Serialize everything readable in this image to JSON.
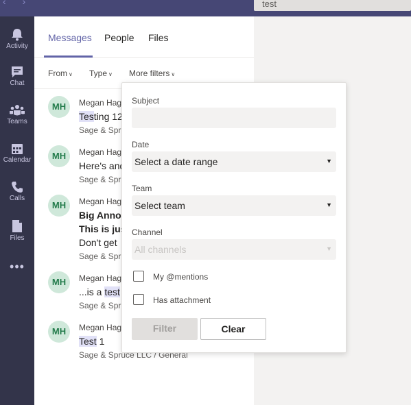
{
  "topbar": {
    "search_value": "test"
  },
  "rail": {
    "items": [
      {
        "label": "Activity",
        "icon": "bell-icon"
      },
      {
        "label": "Chat",
        "icon": "chat-icon"
      },
      {
        "label": "Teams",
        "icon": "teams-icon"
      },
      {
        "label": "Calendar",
        "icon": "calendar-icon"
      },
      {
        "label": "Calls",
        "icon": "phone-icon"
      },
      {
        "label": "Files",
        "icon": "files-icon"
      }
    ],
    "more": "•••"
  },
  "tabs": {
    "messages": "Messages",
    "people": "People",
    "files": "Files"
  },
  "filters": {
    "from": "From",
    "type": "Type",
    "more": "More filters"
  },
  "results": [
    {
      "initials": "MH",
      "sender": "Megan Hag",
      "hl": "Tes",
      "rest": "ting 12",
      "channel": "Sage & Spru"
    },
    {
      "initials": "MH",
      "sender": "Megan Hag",
      "text": "Here's and",
      "channel": "Sage & Spru"
    },
    {
      "initials": "MH",
      "sender": "Megan Hag",
      "bold1": "Big Annou",
      "bold2": "This is jus",
      "text": "Don't get",
      "channel": "Sage & Spru"
    },
    {
      "initials": "MH",
      "sender": "Megan Hag",
      "pre": "...is a ",
      "hl": "test",
      "channel": "Sage & Spru"
    },
    {
      "initials": "MH",
      "sender": "Megan Hag",
      "hl": "Test",
      "rest": " 1",
      "channel": "Sage & Spruce LLC / General"
    }
  ],
  "popover": {
    "subject_label": "Subject",
    "subject_value": "",
    "date_label": "Date",
    "date_value": "Select a date range",
    "team_label": "Team",
    "team_value": "Select team",
    "channel_label": "Channel",
    "channel_value": "All channels",
    "mentions_label": "My @mentions",
    "attachment_label": "Has attachment",
    "filter_button": "Filter",
    "clear_button": "Clear"
  },
  "colors": {
    "accent": "#6264a7",
    "rail": "#33344a",
    "topbar": "#464775",
    "avatar_bg": "#cfe8da",
    "avatar_text": "#237b4b"
  }
}
